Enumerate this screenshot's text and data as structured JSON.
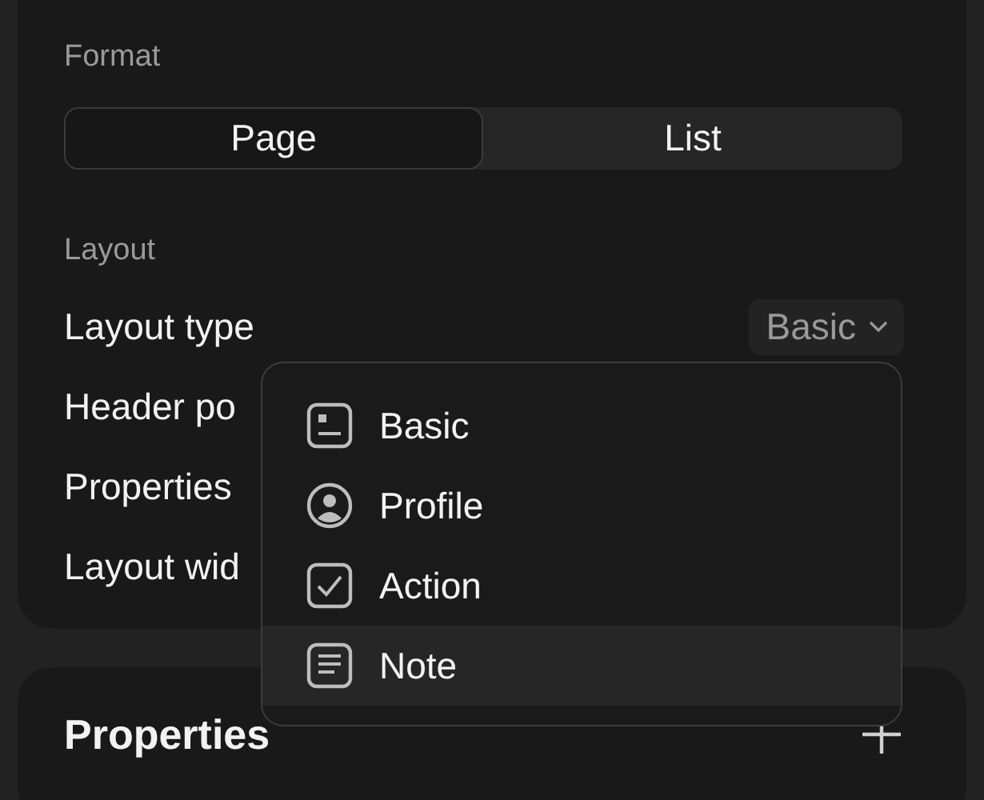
{
  "format": {
    "label": "Format",
    "options": [
      {
        "label": "Page",
        "selected": true
      },
      {
        "label": "List",
        "selected": false
      }
    ]
  },
  "layout": {
    "label": "Layout",
    "rows": [
      {
        "label": "Layout type",
        "value": "Basic"
      },
      {
        "label": "Header po"
      },
      {
        "label": "Properties"
      },
      {
        "label": "Layout wid"
      }
    ]
  },
  "dropdown": {
    "items": [
      {
        "kind": "basic",
        "label": "Basic",
        "selected": false
      },
      {
        "kind": "profile",
        "label": "Profile",
        "selected": false
      },
      {
        "kind": "action",
        "label": "Action",
        "selected": false
      },
      {
        "kind": "note",
        "label": "Note",
        "selected": true
      }
    ]
  },
  "properties": {
    "title": "Properties"
  }
}
